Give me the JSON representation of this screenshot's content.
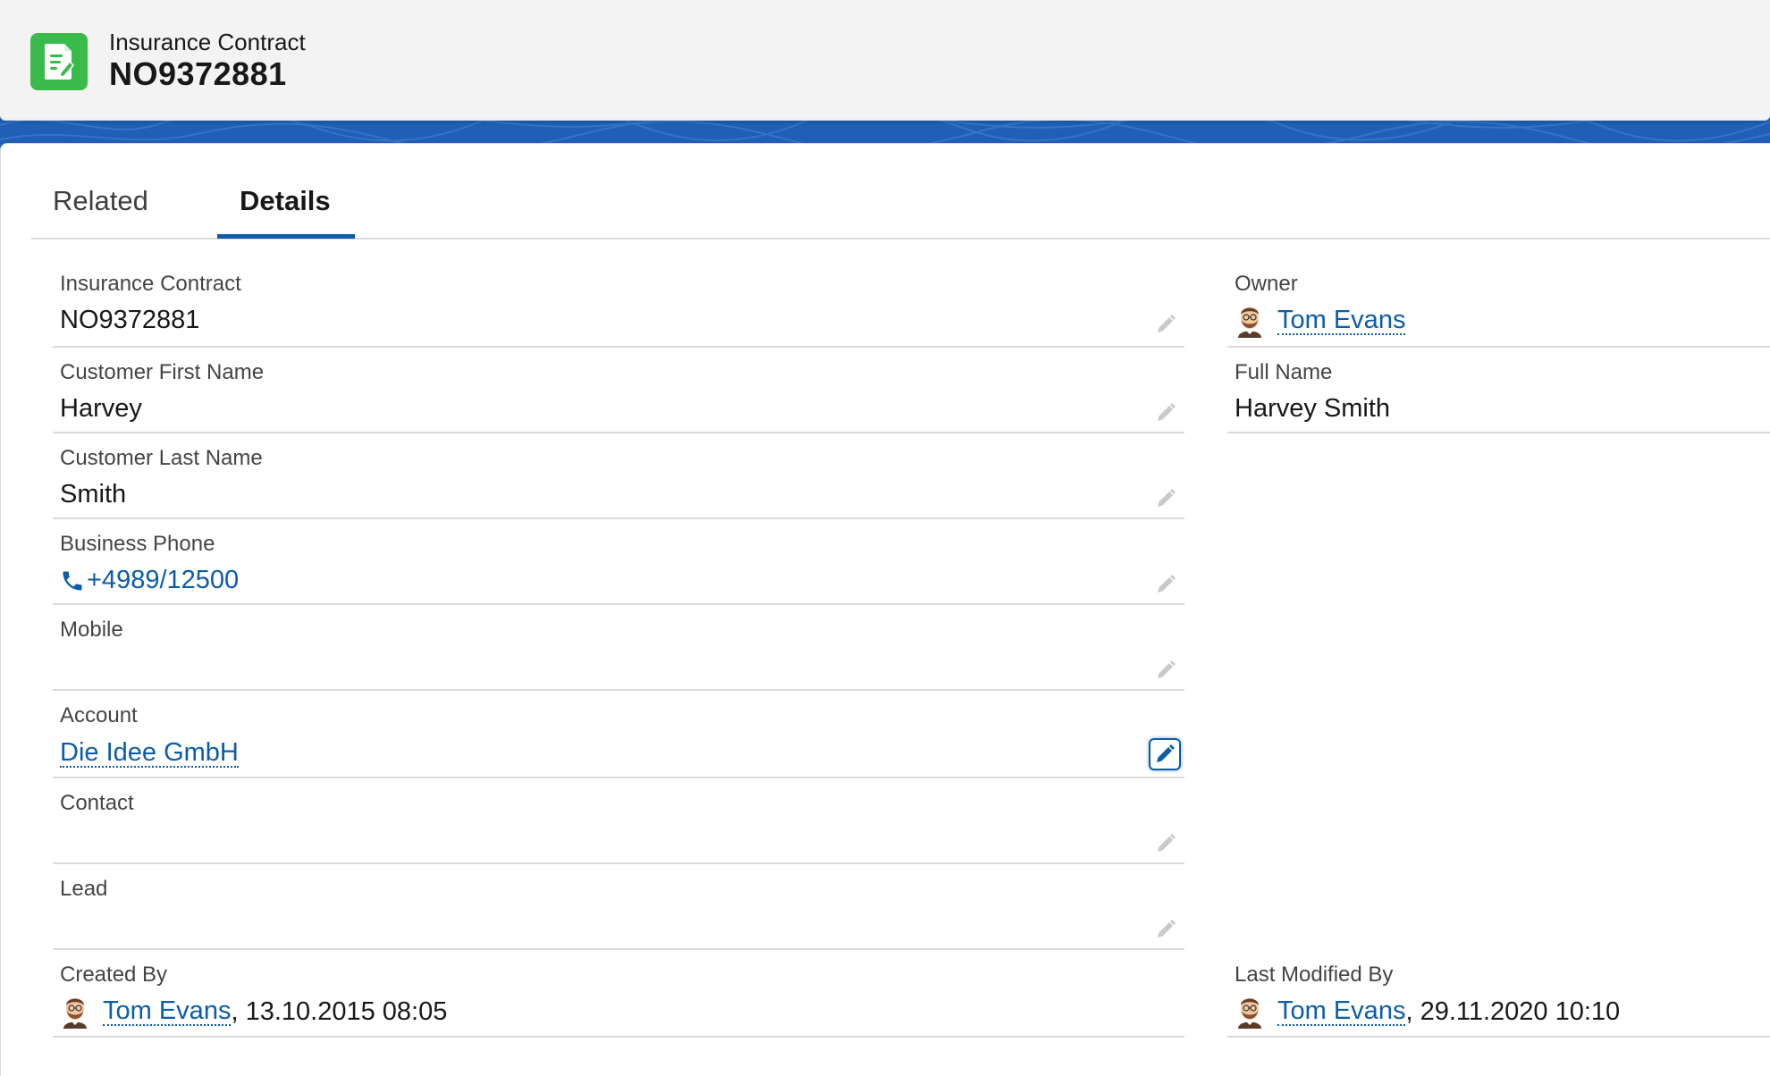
{
  "header": {
    "object_label": "Insurance Contract",
    "record_title": "NO9372881",
    "icon": "contract-icon",
    "icon_color": "#3bba4c"
  },
  "tabs": [
    {
      "label": "Related",
      "active": false
    },
    {
      "label": "Details",
      "active": true
    }
  ],
  "left_fields": {
    "insurance_contract": {
      "label": "Insurance Contract",
      "value": "NO9372881"
    },
    "customer_first_name": {
      "label": "Customer First Name",
      "value": "Harvey"
    },
    "customer_last_name": {
      "label": "Customer Last Name",
      "value": "Smith"
    },
    "business_phone": {
      "label": "Business Phone",
      "value": "+4989/12500",
      "icon": "phone-icon"
    },
    "mobile": {
      "label": "Mobile",
      "value": ""
    },
    "account": {
      "label": "Account",
      "value": "Die Idee GmbH"
    },
    "contact": {
      "label": "Contact",
      "value": ""
    },
    "lead": {
      "label": "Lead",
      "value": ""
    },
    "created_by": {
      "label": "Created By",
      "user": "Tom Evans",
      "timestamp": ", 13.10.2015 08:05"
    }
  },
  "right_fields": {
    "owner": {
      "label": "Owner",
      "user": "Tom Evans"
    },
    "full_name": {
      "label": "Full Name",
      "value": "Harvey Smith"
    },
    "last_modified_by": {
      "label": "Last Modified By",
      "user": "Tom Evans",
      "timestamp": ", 29.11.2020 10:10"
    }
  },
  "colors": {
    "link": "#0b5cab",
    "band": "#1f5fb5",
    "divider": "#dddbda"
  }
}
